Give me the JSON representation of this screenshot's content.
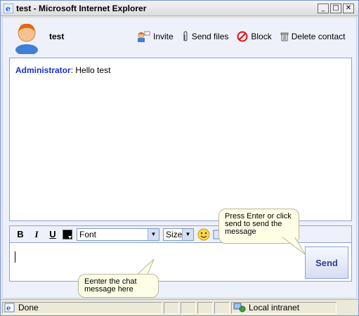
{
  "window": {
    "title": "test - Microsoft Internet Explorer",
    "minimize": "_",
    "maximize": "□",
    "close": "✕"
  },
  "header": {
    "user_name": "test",
    "actions": [
      {
        "label": "Invite",
        "icon": "invite-icon"
      },
      {
        "label": "Send files",
        "icon": "paperclip-icon"
      },
      {
        "label": "Block",
        "icon": "block-icon"
      },
      {
        "label": "Delete contact",
        "icon": "trash-icon"
      }
    ]
  },
  "chat": {
    "messages": [
      {
        "user": "Administrator",
        "separator": ":",
        "text": "Hello test"
      }
    ]
  },
  "format_toolbar": {
    "bold": "B",
    "italic": "I",
    "underline": "U",
    "text_color": "#000000",
    "font_select": "Font",
    "size_select": "Size",
    "emoticon_icon": "smiley-icon"
  },
  "input": {
    "value": ""
  },
  "send_button": {
    "label": "Send"
  },
  "hints": {
    "send_hint": "Press Enter or click send to send the message",
    "input_hint": "Eenter the chat message here"
  },
  "status_bar": {
    "status": "Done",
    "zone": "Local intranet"
  },
  "colors": {
    "accent": "#1a2fd0",
    "panel_bg": "#eef0fa",
    "border": "#8aa2d8",
    "tooltip_bg": "#fefee6"
  }
}
